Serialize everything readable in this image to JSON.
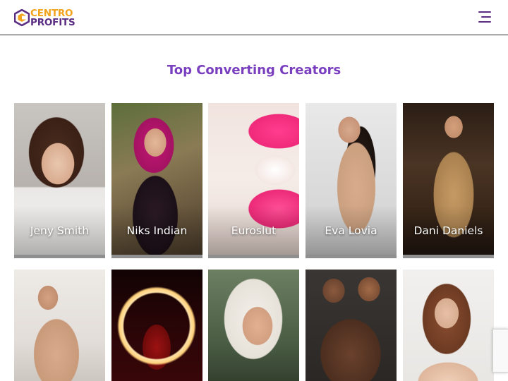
{
  "header": {
    "logo_line1": "CENTRO",
    "logo_line2": "PROFITS",
    "menu_icon": "hamburger-menu-icon"
  },
  "section": {
    "title": "Top Converting Creators"
  },
  "creators_row1": [
    {
      "name": "Jeny Smith"
    },
    {
      "name": "Niks Indian"
    },
    {
      "name": "Euroslut"
    },
    {
      "name": "Eva Lovia"
    },
    {
      "name": "Dani Daniels"
    }
  ],
  "colors": {
    "brand_purple": "#5a2d82",
    "brand_orange": "#f2a31b",
    "title_purple": "#7a3fbf"
  }
}
